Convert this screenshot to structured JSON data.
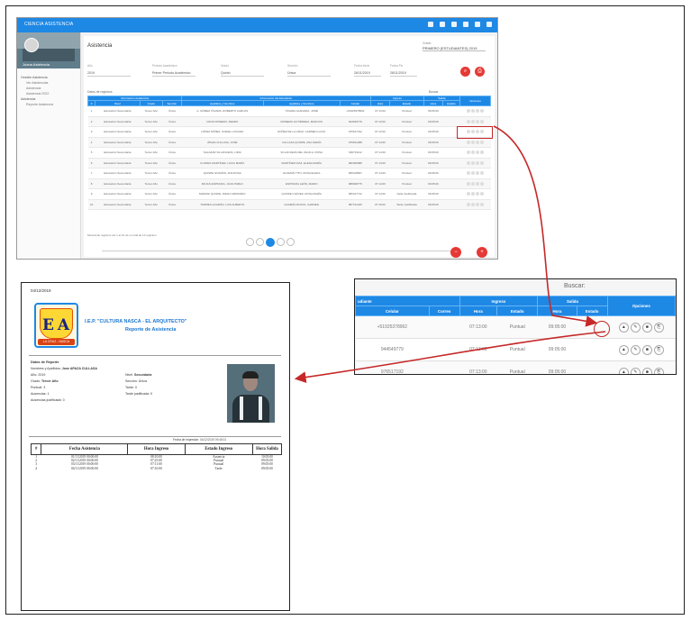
{
  "app": {
    "window_title": "CIENCIA ASISTENCIA",
    "sidebar": {
      "user": "Juana Asistencia",
      "items": [
        {
          "label": "Gestión Asistencia",
          "sub": false
        },
        {
          "label": "Ver Asistencias",
          "sub": true
        },
        {
          "label": "Asistencia",
          "sub": true
        },
        {
          "label": "Asistencia 2022",
          "sub": true
        },
        {
          "label": "Asistencia",
          "sub": false
        },
        {
          "label": "Reporte Asistencia",
          "sub": true
        }
      ]
    },
    "page_title": "Asistencia",
    "grado": {
      "label": "Grado",
      "value": "PRIMERO (ESTUDIANTES) 2019"
    },
    "filters": [
      {
        "label": "Año",
        "value": "2019"
      },
      {
        "label": "Periodo Académico",
        "value": "Primer Periodo Académico"
      },
      {
        "label": "Grado",
        "value": "Quinto"
      },
      {
        "label": "Sección",
        "value": "Única"
      },
      {
        "label": "Fecha Inicio",
        "value": "26/11/2019"
      },
      {
        "label": "Fecha Fin",
        "value": "28/11/2019"
      }
    ],
    "table_label": "Datos de registros",
    "table_label_right": "Buscar",
    "group_headers": [
      "Información Académica",
      "Información del Estudiante",
      "Ingreso",
      "Salida",
      "Opciones"
    ],
    "headers": [
      "#",
      "Nivel",
      "Grado",
      "Sección",
      "Apellidos y Nombres",
      "Apellidos y Nombres",
      "Celular",
      "Hora",
      "Estado",
      "Hora",
      "Estado",
      "Opciones"
    ],
    "rows": [
      [
        "1",
        "Educación Secundaria",
        "Tercer Año",
        "Única",
        "A. GÓMEZ TÁVARA, ROBERTO CARLOS",
        "TÁVARA GUEVARA, JOSÉ",
        "+51925378962",
        "07:13:00",
        "Puntual",
        "09:05:00"
      ],
      [
        "2",
        "Educación Secundaria",
        "Tercer Año",
        "Única",
        "CRUZ ROMERO, PEDRO",
        "ROMERO GUTIÉRREZ, MARCOS",
        "944549779",
        "07:13:00",
        "Puntual",
        "09:05:00"
      ],
      [
        "3",
        "Educación Secundaria",
        "Tercer Año",
        "Única",
        "LÓPEZ NÚÑEZ, JORGE LUCIANO",
        "NÚÑEZ DE LA CRUZ, CARMEN LUCÍA",
        "976517192",
        "07:13:00",
        "Puntual",
        "09:05:00"
      ],
      [
        "4",
        "Educación Secundaria",
        "Tercer Año",
        "Única",
        "ÁPAZA CULLASA, JOSÉ",
        "CULLASA QUISPE, ANA MARÍA",
        "976541288",
        "07:14:00",
        "Puntual",
        "09:05:00"
      ],
      [
        "5",
        "Educación Secundaria",
        "Tercer Año",
        "Única",
        "SALAZAR VILLANUEVA, LIDIA",
        "VILLANUEVA DEL ÁGUILA, ROSA",
        "930731112",
        "07:14:00",
        "Puntual",
        "09:05:00"
      ],
      [
        "6",
        "Educación Secundaria",
        "Tercer Año",
        "Única",
        "FLORES MARTÍNEZ, LUCIA MARÍA",
        "MARTÍNEZ DIAZ, ELENA MARÍA",
        "982496588",
        "07:14:00",
        "Puntual",
        "09:05:00"
      ],
      [
        "7",
        "Educación Secundaria",
        "Tercer Año",
        "Única",
        "QUISPE HUAMÁN, ANA ROSA",
        "HUAMÁN TITO, ROSA ELENA",
        "965418847",
        "07:14:00",
        "Puntual",
        "09:05:00"
      ],
      [
        "8",
        "Educación Secundaria",
        "Tercer Año",
        "Única",
        "ROJAS ESPINOZA, JUAN PABLO",
        "ESPINOZA LEÓN, MARIO",
        "988498775",
        "07:14:00",
        "Puntual",
        "09:05:00"
      ],
      [
        "9",
        "Educación Secundaria",
        "Tercer Año",
        "Única",
        "MAMANI QUISPE, DIEGO ARMANDO",
        "QUISPE CHÁVEZ, ROSA MARÍA",
        "965417712",
        "07:14:00",
        "Falta Justificada",
        "09:05:00"
      ],
      [
        "10",
        "Educación Secundaria",
        "Tercer Año",
        "Única",
        "TORRES HUAMÁN, LUIS ALBERTO",
        "HUAMÁN ROJAS, CARMEN",
        "987741225",
        "07:15:00",
        "Tarde Justificada",
        "09:05:00"
      ]
    ],
    "table_footer": "Mostrando registros del 1 al 10 de un total de 10 registros",
    "pager": [
      "<<",
      "<",
      "1",
      ">",
      ">>"
    ]
  },
  "zoom": {
    "search_label": "Buscar:",
    "group_headers": [
      "udiante",
      "Ingreso",
      "Salida",
      "Opciones"
    ],
    "headers": [
      "Celular",
      "Correo",
      "Hora",
      "Estado",
      "Hora",
      "Estado"
    ],
    "rows": [
      {
        "celular": "+51925378962",
        "correo": "",
        "hora_in": "07:13:00",
        "estado_in": "Puntual",
        "hora_out": "09:05:00"
      },
      {
        "celular": "944549779",
        "correo": "",
        "hora_in": "07:13:00",
        "estado_in": "Puntual",
        "hora_out": "09:05:00"
      },
      {
        "celular": "976517192",
        "correo": "",
        "hora_in": "07:13:00",
        "estado_in": "Puntual",
        "hora_out": "09:05:00"
      }
    ]
  },
  "report": {
    "date": "04/12/2019",
    "school": "I.E.P. \"CULTURA NASCA - EL ARQUITECTO\"",
    "title": "Reporte de Asistencia",
    "logo_letters": "E A",
    "logo_ribbon": "LA CRUZ - NASCA",
    "section_header": "Datos de Reporte",
    "student_label": "Nombres y Apellidos:",
    "student_name": "Jose APAZA CULLASA",
    "fields_left": [
      {
        "label": "Año:",
        "value": "2019"
      },
      {
        "label": "Grado:",
        "value": "Tercer Año"
      },
      {
        "label": "Puntual:",
        "value": "3"
      },
      {
        "label": "Ausencias:",
        "value": "1"
      },
      {
        "label": "Ausencias justificada:",
        "value": "0"
      }
    ],
    "fields_right": [
      {
        "label": "Nivel:",
        "value": "Secundaria"
      },
      {
        "label": "Sección:",
        "value": "Única"
      },
      {
        "label": "Tarde:",
        "value": "0"
      },
      {
        "label": "Tarde justificada:",
        "value": "0"
      }
    ],
    "firma_label": "Fecha de Impresión:",
    "firma_value": "04/12/2019 09:45:01",
    "table_headers": [
      "#",
      "Fecha Asistencia",
      "Hora Ingreso",
      "Estado Ingreso",
      "Hora Salida"
    ],
    "table_rows": [
      [
        "1",
        "01/11/2019 00:00:00",
        "08:10:00",
        "Ausencia",
        "10:05:00"
      ],
      [
        "2",
        "02/11/2019 00:00:00",
        "07:25:00",
        "Puntual",
        "09:05:00"
      ],
      [
        "3",
        "03/11/2019 00:00:00",
        "07:11:00",
        "Puntual",
        "09:05:00"
      ],
      [
        "4",
        "04/11/2019 00:00:00",
        "07:10:00",
        "Tarde",
        "09:05:00"
      ]
    ]
  },
  "colors": {
    "accent": "#1e88e5",
    "highlight": "#c62828",
    "fab": "#e53935"
  }
}
